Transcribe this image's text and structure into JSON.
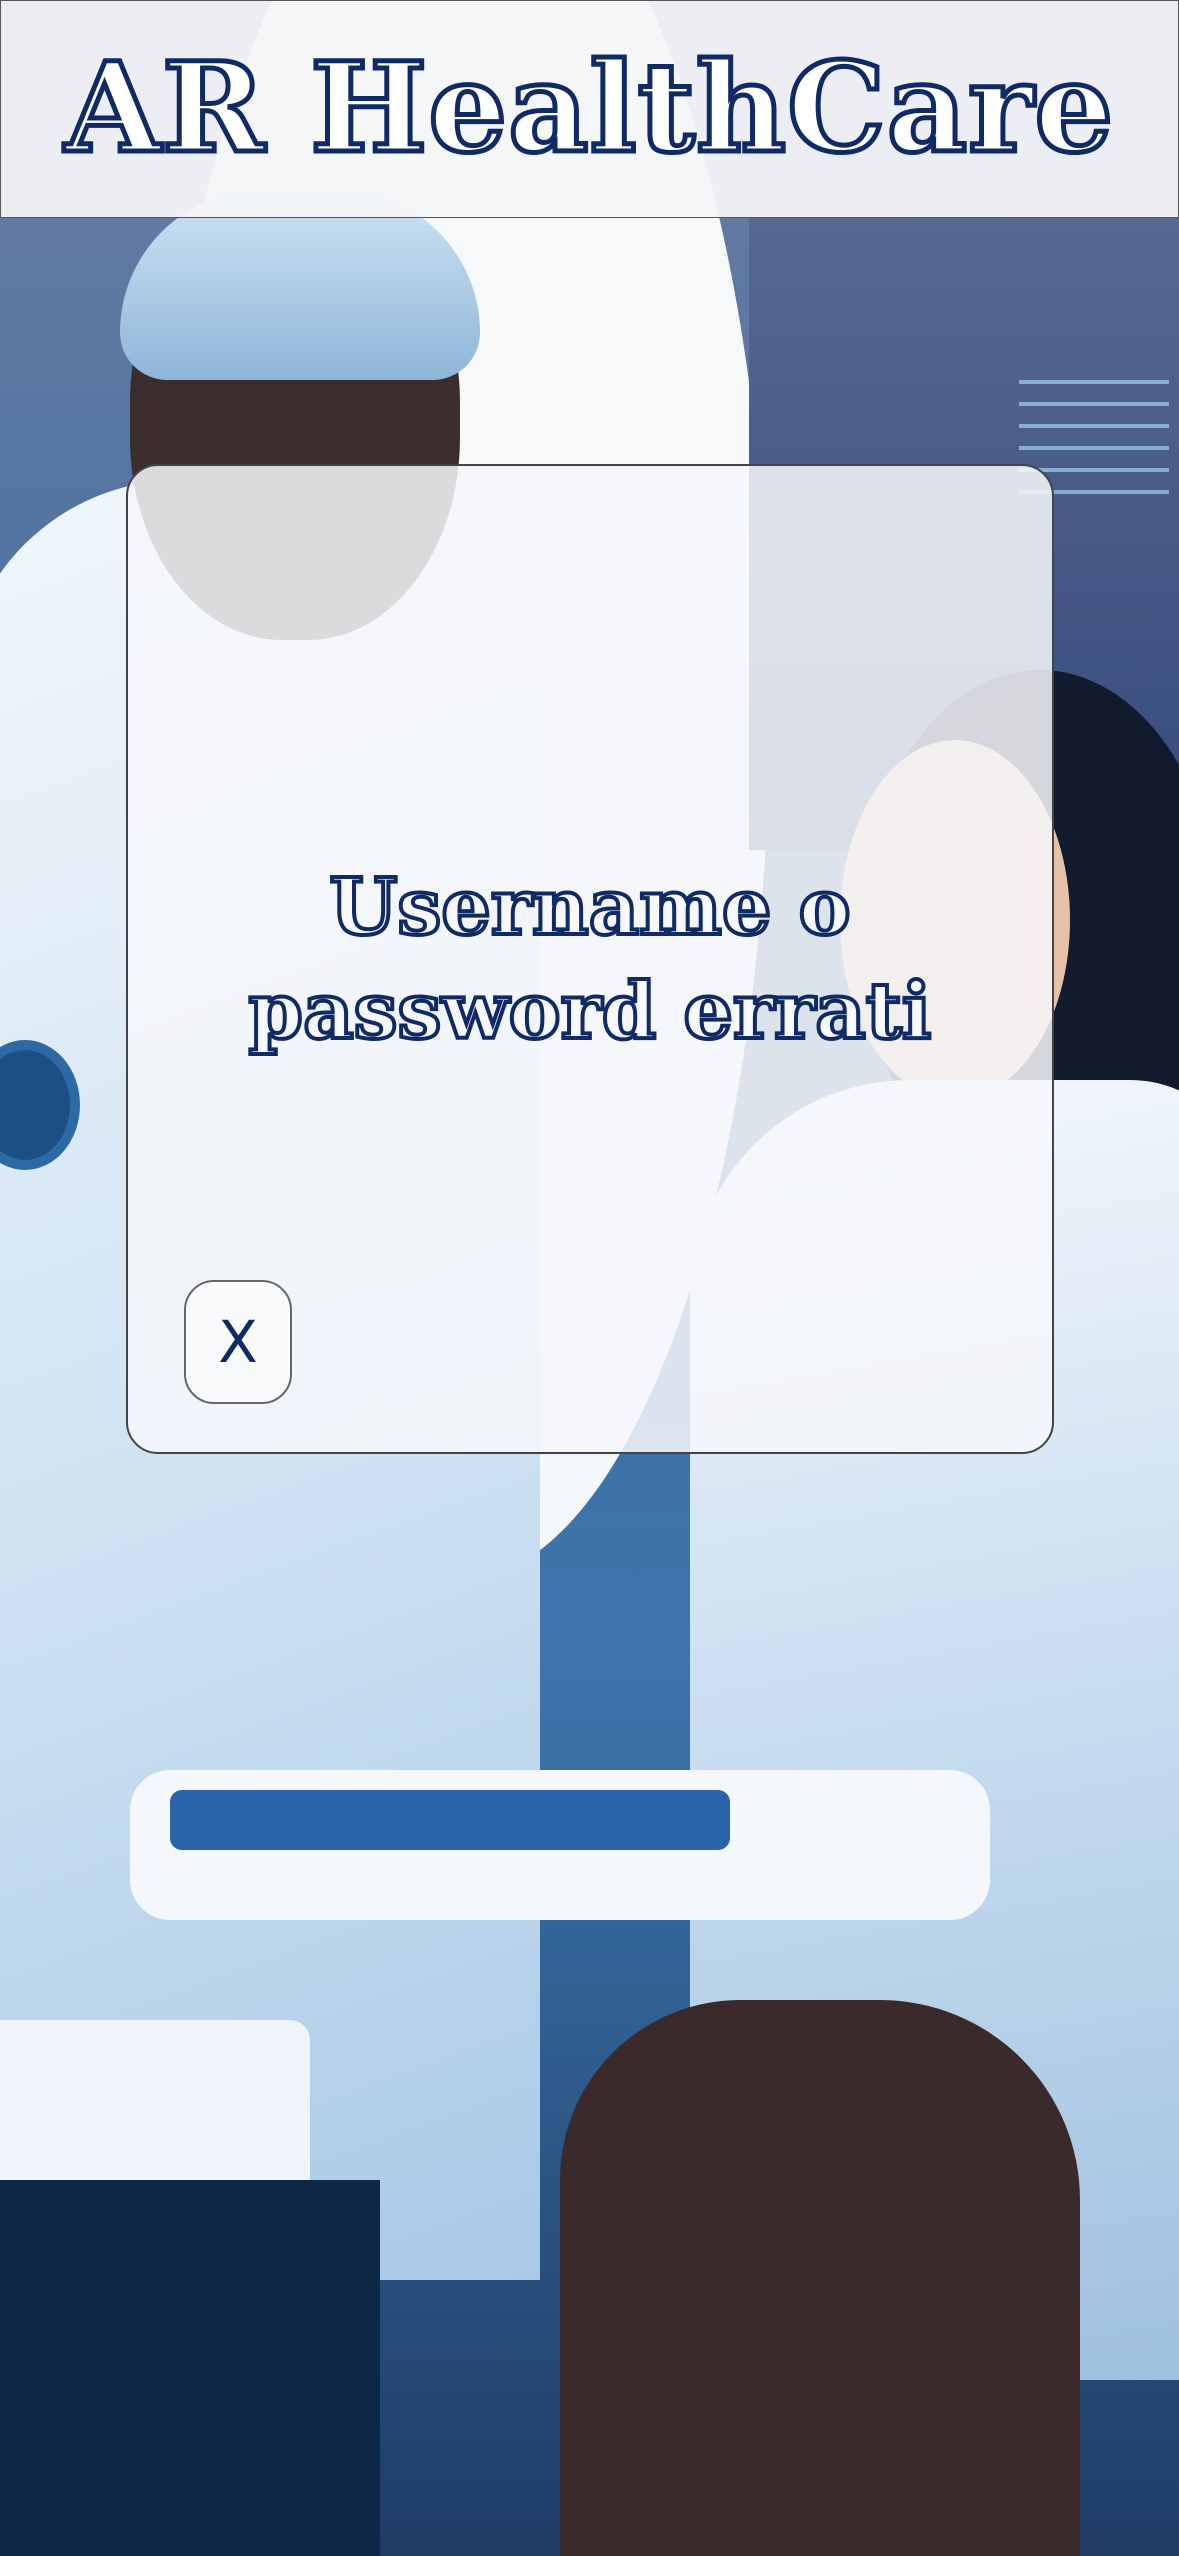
{
  "header": {
    "title": "AR HealthCare"
  },
  "dialog": {
    "message_line1": "Username o",
    "message_line2": "password errati",
    "close_label": "X"
  },
  "colors": {
    "brand_navy": "#102a66",
    "header_bg": "#f4f5f8",
    "dialog_bg": "#f6f7fa"
  }
}
